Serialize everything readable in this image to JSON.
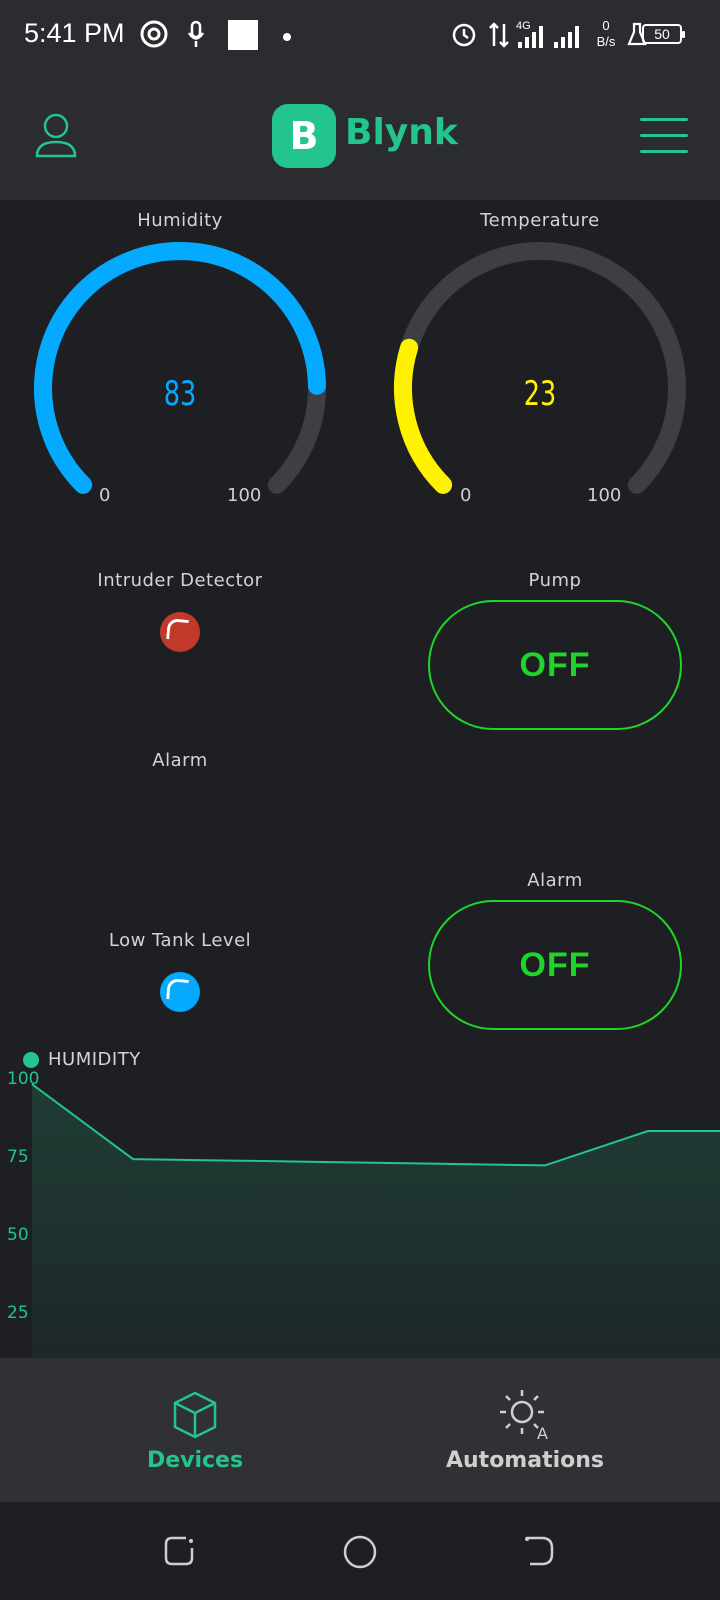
{
  "status_bar": {
    "time": "5:41 PM",
    "network_type": "4G",
    "data_rate_value": "0",
    "data_rate_unit": "B/s",
    "battery": "50"
  },
  "header": {
    "logo_letter": "B",
    "brand": "Blynk"
  },
  "widgets": {
    "humidity": {
      "label": "Humidity",
      "value": "83",
      "min": "0",
      "max": "100",
      "color": "#04aaff"
    },
    "temperature": {
      "label": "Temperature",
      "value": "23",
      "min": "0",
      "max": "100",
      "color": "#fff200"
    },
    "intruder": {
      "label": "Intruder Detector",
      "color": "#c0392b"
    },
    "pump": {
      "label": "Pump",
      "state": "OFF"
    },
    "alarm_label": {
      "label": "Alarm"
    },
    "alarm_button": {
      "label": "Alarm",
      "state": "OFF"
    },
    "low_tank": {
      "label": "Low Tank Level",
      "color": "#04aaff"
    }
  },
  "chart_data": {
    "type": "area",
    "legend": "HUMIDITY",
    "series": [
      {
        "name": "HUMIDITY",
        "color": "#23c48e",
        "values": [
          98,
          74,
          73.5,
          73,
          72.5,
          72,
          83,
          83
        ]
      }
    ],
    "yticks": [
      "100",
      "75",
      "50",
      "25"
    ],
    "ylim": [
      0,
      100
    ]
  },
  "bottom_nav": {
    "devices": "Devices",
    "automations": "Automations",
    "automations_icon_letter": "A"
  },
  "colors": {
    "accent": "#23c48e",
    "button_green": "#1fd52a",
    "background": "#1e1f22"
  }
}
